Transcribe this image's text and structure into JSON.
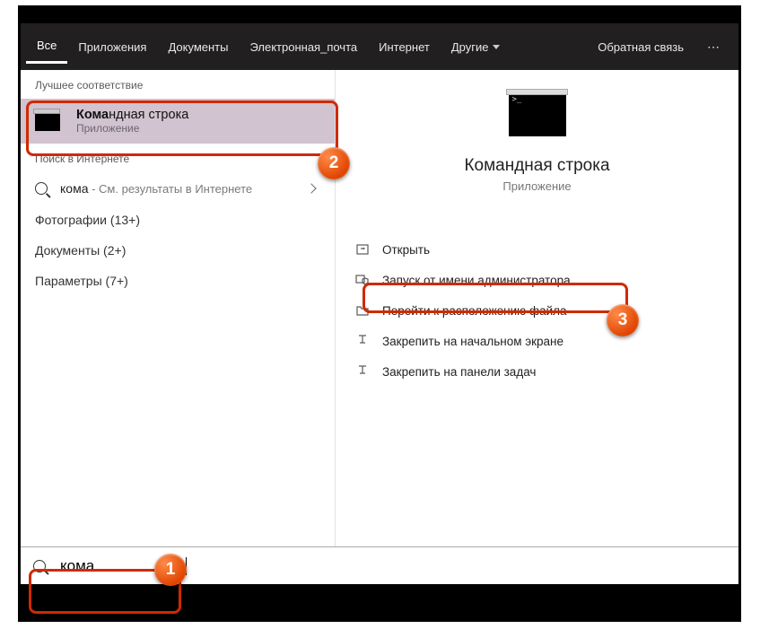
{
  "topbar": {
    "tabs": [
      "Все",
      "Приложения",
      "Документы",
      "Электронная_почта",
      "Интернет",
      "Другие"
    ],
    "feedback": "Обратная связь"
  },
  "left": {
    "best_match_label": "Лучшее соответствие",
    "best_match": {
      "title_hl": "Кома",
      "title_rest": "ндная строка",
      "subtitle": "Приложение"
    },
    "web_label": "Поиск в Интернете",
    "web_query": "кома",
    "web_suffix": " - См. результаты в Интернете",
    "categories": [
      {
        "label": "Фотографии",
        "count": "13+"
      },
      {
        "label": "Документы",
        "count": "2+"
      },
      {
        "label": "Параметры",
        "count": "7+"
      }
    ]
  },
  "right": {
    "title": "Командная строка",
    "subtitle": "Приложение",
    "actions": [
      "Открыть",
      "Запуск от имени администратора",
      "Перейти к расположению файла",
      "Закрепить на начальном экране",
      "Закрепить на панели задач"
    ]
  },
  "search": {
    "value": "кома"
  },
  "annotations": {
    "n1": "1",
    "n2": "2",
    "n3": "3"
  }
}
